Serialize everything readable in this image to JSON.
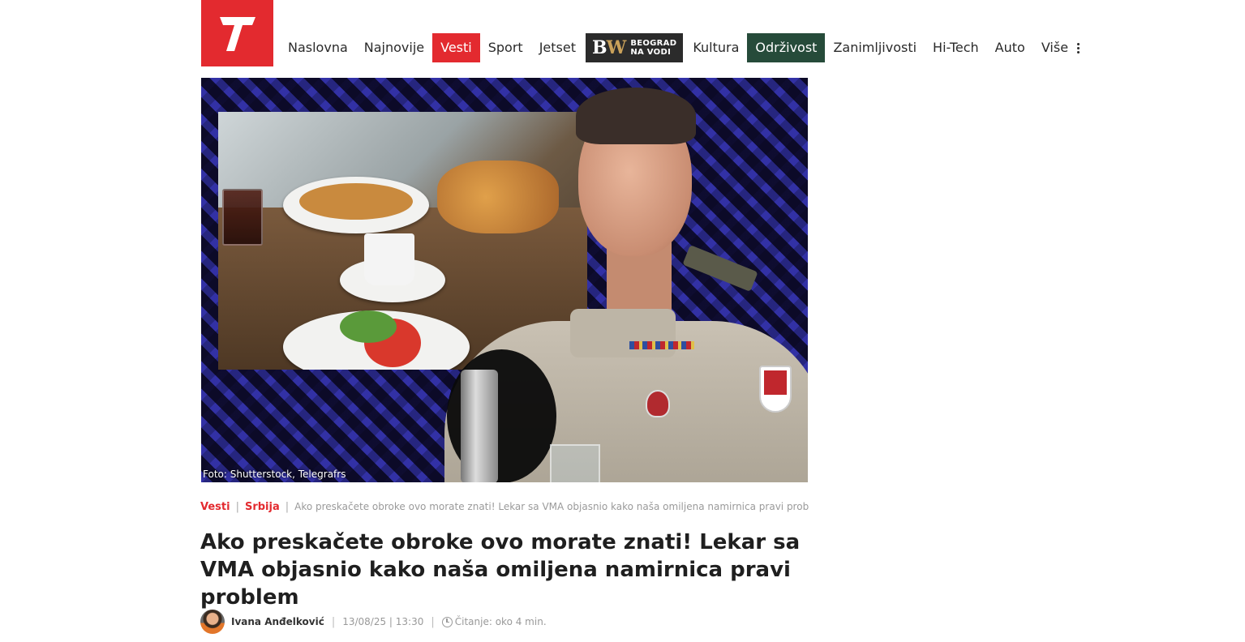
{
  "header": {
    "logo_text": "T",
    "nav": [
      {
        "label": "Naslovna",
        "style": "plain"
      },
      {
        "label": "Najnovije",
        "style": "plain"
      },
      {
        "label": "Vesti",
        "style": "red"
      },
      {
        "label": "Sport",
        "style": "plain"
      },
      {
        "label": "Jetset",
        "style": "plain"
      },
      {
        "label": "Kultura",
        "style": "plain"
      },
      {
        "label": "Održivost",
        "style": "green"
      },
      {
        "label": "Zanimljivosti",
        "style": "plain"
      },
      {
        "label": "Hi-Tech",
        "style": "plain"
      },
      {
        "label": "Auto",
        "style": "plain"
      },
      {
        "label": "Više",
        "style": "plain"
      }
    ],
    "bw_banner": {
      "mark": "BW",
      "line1": "BEOGRAD",
      "line2": "NA VODI"
    }
  },
  "hero": {
    "photo_credit": "Foto: Shutterstock, Telegrafrs"
  },
  "breadcrumb": {
    "section": "Vesti",
    "subsection": "Srbija",
    "current": "Ako preskačete obroke ovo morate znati! Lekar sa VMA objasnio kako naša omiljena namirnica pravi problem"
  },
  "article": {
    "title": "Ako preskačete obroke ovo morate znati! Lekar sa VMA objasnio kako naša omiljena namirnica pravi problem",
    "author": "Ivana Anđelković",
    "date": "13/08/25 | 13:30",
    "reading_time": "Čitanje: oko 4 min."
  },
  "colors": {
    "brand_red": "#e32a2f",
    "green": "#264b3a",
    "bw_dark": "#2b2b2b"
  }
}
